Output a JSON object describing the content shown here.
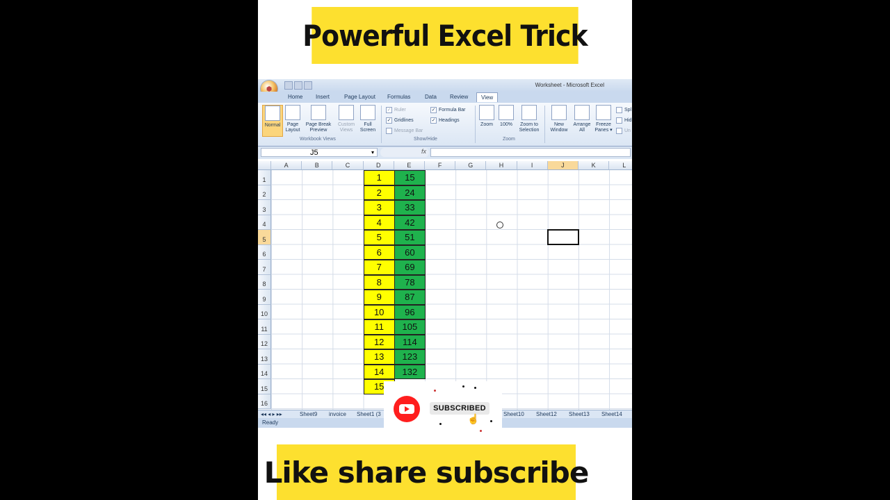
{
  "banners": {
    "top": "Powerful Excel Trick",
    "bottom": "Like share subscribe"
  },
  "excel": {
    "window_title": "Worksheet - Microsoft Excel",
    "office_button_icon": "office-logo-icon",
    "tabs": [
      "Home",
      "Insert",
      "Page Layout",
      "Formulas",
      "Data",
      "Review",
      "View"
    ],
    "active_tab": "View",
    "ribbon": {
      "workbook_views": {
        "label": "Workbook Views",
        "normal": "Normal",
        "page_layout": [
          "Page",
          "Layout"
        ],
        "page_break_preview": [
          "Page Break",
          "Preview"
        ],
        "custom_views": [
          "Custom",
          "Views"
        ],
        "full_screen": [
          "Full",
          "Screen"
        ]
      },
      "show_hide": {
        "label": "Show/Hide",
        "ruler": "Ruler",
        "gridlines": "Gridlines",
        "message_bar": "Message Bar",
        "formula_bar": "Formula Bar",
        "headings": "Headings"
      },
      "zoom": {
        "label": "Zoom",
        "zoom": "Zoom",
        "hundred": "100%",
        "zoom_to_selection": [
          "Zoom to",
          "Selection"
        ]
      },
      "window": {
        "new_window": [
          "New",
          "Window"
        ],
        "arrange_all": [
          "Arrange",
          "All"
        ],
        "freeze_panes": [
          "Freeze",
          "Panes ▾"
        ],
        "split": "Spl",
        "hide": "Hid",
        "unhide": "Un"
      }
    },
    "name_box": "J5",
    "fx": "fx",
    "columns": [
      "A",
      "B",
      "C",
      "D",
      "E",
      "F",
      "G",
      "H",
      "I",
      "J",
      "K",
      "L"
    ],
    "selected_column": "J",
    "rows": [
      "1",
      "2",
      "3",
      "4",
      "5",
      "6",
      "7",
      "8",
      "9",
      "10",
      "11",
      "12",
      "13",
      "14",
      "15",
      "16"
    ],
    "selected_row": "5",
    "column_d": [
      "1",
      "2",
      "3",
      "4",
      "5",
      "6",
      "7",
      "8",
      "9",
      "10",
      "11",
      "12",
      "13",
      "14",
      "15"
    ],
    "column_e": [
      "15",
      "24",
      "33",
      "42",
      "51",
      "60",
      "69",
      "78",
      "87",
      "96",
      "105",
      "114",
      "123",
      "132"
    ],
    "sheet_tabs": [
      "Sheet9",
      "invoice",
      "Sheet1 (3",
      "Sheet10",
      "Sheet12",
      "Sheet13",
      "Sheet14"
    ],
    "sheet_nav": "◂◂ ◂ ▸ ▸▸",
    "status": "Ready"
  },
  "subscribe_overlay": {
    "logo_icon": "youtube-logo-icon",
    "button_label": "SUBSCRIBED",
    "cursor_icon": "hand-pointer-icon"
  },
  "colors": {
    "banner": "#fde02f",
    "column_d_fill": "#ffff00",
    "column_e_fill": "#1fb24d",
    "youtube_red": "#ff1e1e"
  }
}
